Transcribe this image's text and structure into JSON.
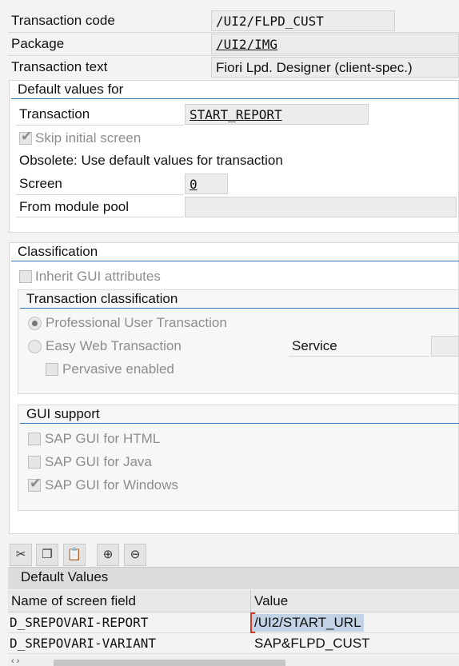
{
  "header": {
    "transaction_code_label": "Transaction code",
    "transaction_code_value": "/UI2/FLPD_CUST",
    "package_label": "Package",
    "package_value": "/UI2/IMG",
    "transaction_text_label": "Transaction text",
    "transaction_text_value": "Fiori Lpd. Designer (client-spec.)"
  },
  "defaults": {
    "group_title": "Default values for",
    "transaction_label": "Transaction",
    "transaction_value": "START_REPORT",
    "skip_initial_screen_label": "Skip initial screen",
    "skip_initial_screen_checked": true,
    "obsolete_text": "Obsolete: Use default values for transaction",
    "screen_label": "Screen",
    "screen_value": "0",
    "module_pool_label": "From module pool",
    "module_pool_value": ""
  },
  "classification": {
    "group_title": "Classification",
    "inherit_gui_label": "Inherit GUI attributes",
    "inherit_gui_checked": false,
    "transaction_classification_title": "Transaction classification",
    "professional_label": "Professional User Transaction",
    "professional_selected": true,
    "easy_web_label": "Easy Web Transaction",
    "easy_web_selected": false,
    "service_label": "Service",
    "pervasive_label": "Pervasive enabled",
    "pervasive_checked": false
  },
  "gui_support": {
    "group_title": "GUI support",
    "html_label": "SAP GUI for HTML",
    "html_checked": false,
    "java_label": "SAP GUI for Java",
    "java_checked": false,
    "windows_label": "SAP GUI for Windows",
    "windows_checked": true
  },
  "toolbar": {
    "icons": [
      "cut-icon",
      "copy-icon",
      "paste-icon",
      "insert-row-icon",
      "delete-row-icon"
    ]
  },
  "default_values_table": {
    "title": "Default Values",
    "columns": [
      "Name of screen field",
      "Value"
    ],
    "rows": [
      {
        "name": "D_SREPOVARI-REPORT",
        "value": "/UI2/START_URL"
      },
      {
        "name": "D_SREPOVARI-VARIANT",
        "value": "SAP&FLPD_CUST"
      }
    ]
  },
  "colors": {
    "group_line": "#2f77b8",
    "selection": "#c3d3e6"
  }
}
